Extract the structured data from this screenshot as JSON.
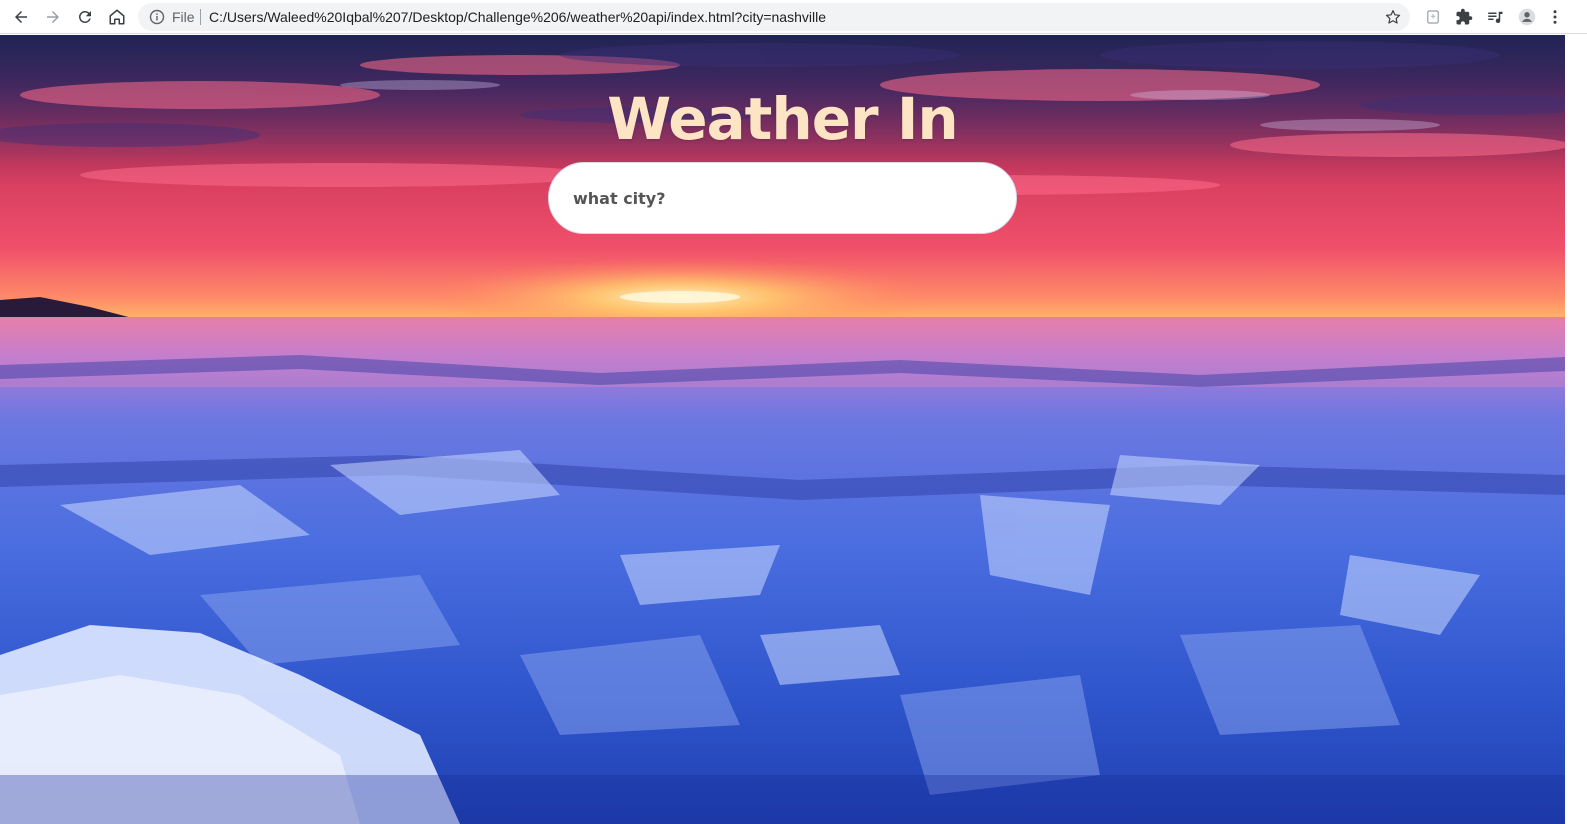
{
  "browser": {
    "url_scheme_label": "File",
    "url": "C:/Users/Waleed%20Iqbal%207/Desktop/Challenge%206/weather%20api/index.html?city=nashville",
    "icons": [
      "back-icon",
      "forward-icon",
      "reload-icon",
      "home-icon",
      "info-icon",
      "star-icon",
      "extension-box-icon",
      "puzzle-icon",
      "media-control-icon",
      "profile-icon",
      "menu-dots-icon"
    ]
  },
  "page": {
    "title": "Weather In",
    "search": {
      "placeholder": "what city?",
      "value": ""
    }
  },
  "colors": {
    "title": "#fde4c4",
    "search_bg": "#ffffff",
    "sky_top": "#3a2a6a",
    "sky_mid": "#e0405a",
    "horizon": "#ffb060",
    "ice_blue": "#3a5ad0"
  }
}
